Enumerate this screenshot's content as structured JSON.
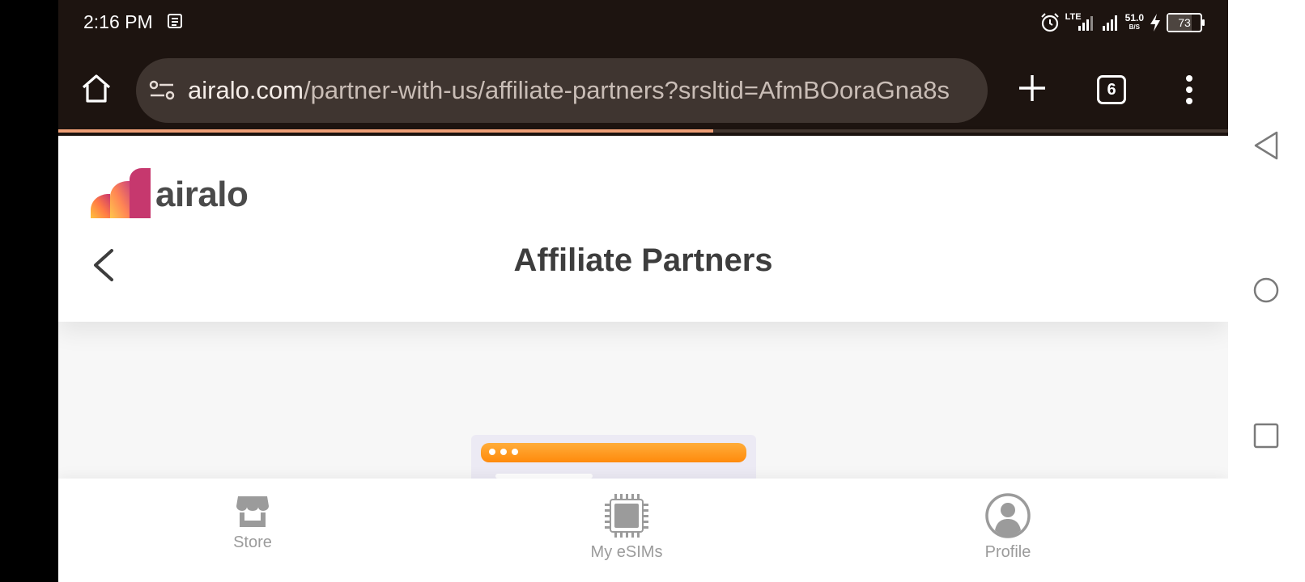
{
  "status_bar": {
    "time": "2:16 PM",
    "network_type": "LTE",
    "speed_value": "51.0",
    "speed_unit": "B/S",
    "battery_level": "73",
    "icons": [
      "news-icon",
      "alarm-icon",
      "signal-icon",
      "charging-icon",
      "battery-icon"
    ]
  },
  "browser": {
    "url_host": "airalo.com",
    "url_path": "/partner-with-us/affiliate-partners?srsltid=AfmBOoraGna8s",
    "tab_count": "6",
    "load_progress": 0.56,
    "icons": [
      "home-icon",
      "site-settings-icon",
      "new-tab-icon",
      "more-menu-icon"
    ]
  },
  "site": {
    "logo_text": "airalo",
    "page_title": "Affiliate Partners",
    "accent_color": "#ff8a0c"
  },
  "bottom_nav": {
    "items": [
      {
        "label": "Store",
        "icon": "store-icon"
      },
      {
        "label": "My eSIMs",
        "icon": "sim-chip-icon"
      },
      {
        "label": "Profile",
        "icon": "profile-icon"
      }
    ]
  },
  "system_nav": [
    "back-icon",
    "home-circle-icon",
    "recents-icon"
  ]
}
